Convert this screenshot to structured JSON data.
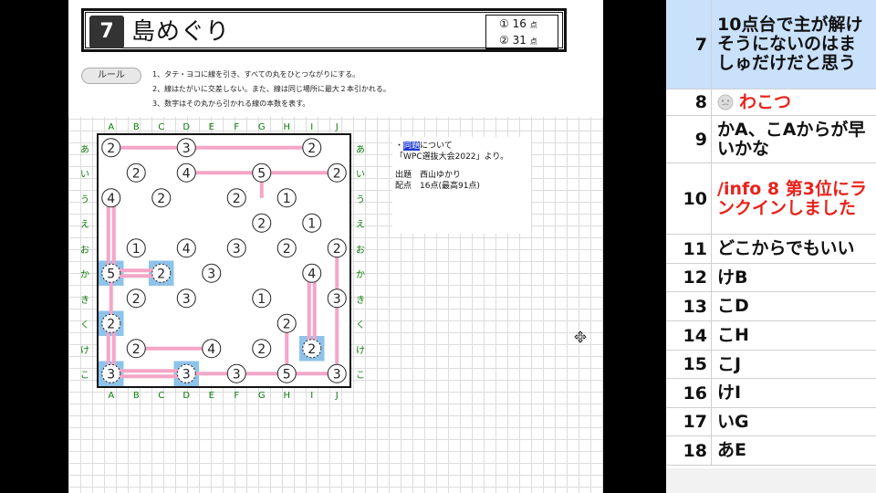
{
  "puzzle": {
    "number": "7",
    "title": "島めぐり",
    "points": [
      {
        "circle": "①",
        "value": "16",
        "unit": "点"
      },
      {
        "circle": "②",
        "value": "31",
        "unit": "点"
      }
    ],
    "rule_label": "ルール",
    "rules": [
      "1、タテ・ヨコに線を引き、すべての丸をひとつながりにする。",
      "2、線はたがいに交差しない。また、線は同じ場所に最大２本引かれる。",
      "3、数字はその丸から引かれる線の本数を表す。"
    ],
    "columns": [
      "A",
      "B",
      "C",
      "D",
      "E",
      "F",
      "G",
      "H",
      "I",
      "J"
    ],
    "rows": [
      "あ",
      "い",
      "う",
      "え",
      "お",
      "か",
      "き",
      "く",
      "け",
      "こ"
    ],
    "grid": [
      [
        "2",
        "",
        "",
        "3",
        "",
        "",
        "",
        "",
        "2",
        ""
      ],
      [
        "",
        "2",
        "",
        "4",
        "",
        "",
        "5",
        "",
        "",
        "2"
      ],
      [
        "4",
        "",
        "2",
        "",
        "",
        "2",
        "",
        "1",
        "",
        ""
      ],
      [
        "",
        "",
        "",
        "",
        "",
        "",
        "2",
        "",
        "1",
        ""
      ],
      [
        "",
        "1",
        "",
        "4",
        "",
        "3",
        "",
        "2",
        "",
        "2"
      ],
      [
        "5",
        "",
        "2",
        "",
        "3",
        "",
        "",
        "",
        "4",
        ""
      ],
      [
        "",
        "2",
        "",
        "3",
        "",
        "",
        "1",
        "",
        "",
        "3"
      ],
      [
        "2",
        "",
        "",
        "",
        "",
        "",
        "",
        "2",
        "",
        ""
      ],
      [
        "",
        "2",
        "",
        "",
        "4",
        "",
        "2",
        "",
        "2",
        ""
      ],
      [
        "3",
        "",
        "",
        "3",
        "",
        "3",
        "",
        "5",
        "",
        "3"
      ]
    ],
    "highlighted": [
      [
        5,
        0
      ],
      [
        5,
        2
      ],
      [
        7,
        0
      ],
      [
        8,
        8
      ],
      [
        9,
        0
      ],
      [
        9,
        3
      ]
    ],
    "dashed": [
      [
        5,
        0
      ],
      [
        5,
        2
      ],
      [
        7,
        0
      ],
      [
        8,
        8
      ],
      [
        9,
        0
      ],
      [
        9,
        3
      ]
    ],
    "line_color": "#f4a6c7",
    "highlight_color": "#8ec3ea"
  },
  "info": {
    "heading": "・同題について",
    "heading_highlight": "同題",
    "source": "「WPC選抜大会2022」より。",
    "author": "出題　西山ゆかり",
    "score": "配点　16点(最高91点)"
  },
  "chat": [
    {
      "num": "7",
      "text": "10点台で主が解けそうにないのはましゅだけだと思う",
      "selected": true,
      "color": "black"
    },
    {
      "num": "8",
      "text": "わこつ",
      "color": "red",
      "icon": "face-icon"
    },
    {
      "num": "9",
      "text": "かA、こAからが早いかな",
      "color": "black"
    },
    {
      "num": "10",
      "text": "/info 8 第3位にランクインしました",
      "color": "red"
    },
    {
      "num": "11",
      "text": "どこからでもいい",
      "color": "black"
    },
    {
      "num": "12",
      "text": "けB",
      "color": "black"
    },
    {
      "num": "13",
      "text": "こD",
      "color": "black"
    },
    {
      "num": "14",
      "text": "こH",
      "color": "black"
    },
    {
      "num": "15",
      "text": "こJ",
      "color": "black"
    },
    {
      "num": "16",
      "text": "けI",
      "color": "black"
    },
    {
      "num": "17",
      "text": "いG",
      "color": "black"
    },
    {
      "num": "18",
      "text": "あE",
      "color": "black"
    }
  ]
}
